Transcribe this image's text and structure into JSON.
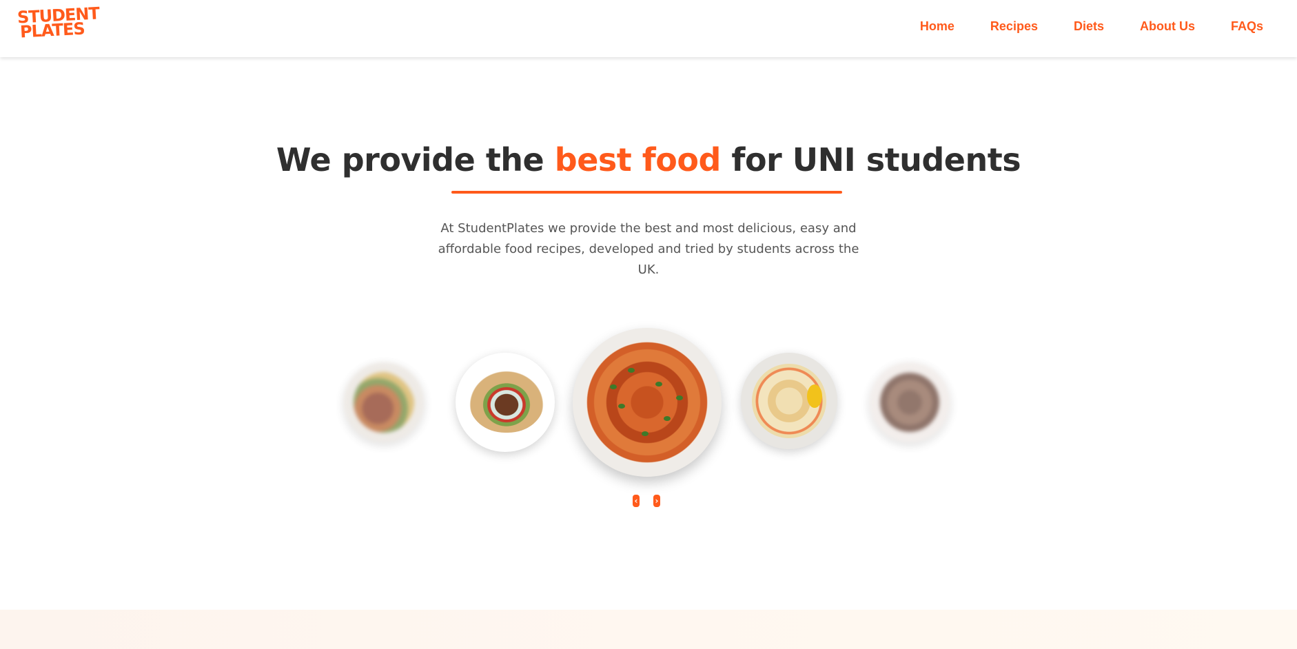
{
  "brand": {
    "logo_line1": "STUDENT",
    "logo_line2": "PLATES",
    "accent_color": "#ff5a1b"
  },
  "nav": {
    "items": [
      {
        "label": "Home"
      },
      {
        "label": "Recipes"
      },
      {
        "label": "Diets"
      },
      {
        "label": "About Us"
      },
      {
        "label": "FAQs"
      }
    ]
  },
  "hero": {
    "title_before": "We provide the ",
    "title_accent": "best food",
    "title_after": " for UNI students",
    "description": "At StudentPlates we provide the best and most delicious, easy and affordable food recipes, developed and tried by students across the UK."
  },
  "carousel": {
    "plates": [
      {
        "name": "grilled-meat-plate",
        "state": "blurred"
      },
      {
        "name": "gyro-wrap-plate",
        "state": "visible"
      },
      {
        "name": "curry-plate",
        "state": "active"
      },
      {
        "name": "shrimp-pasta-plate",
        "state": "visible"
      },
      {
        "name": "stew-plate",
        "state": "blurred"
      }
    ],
    "prev_icon": "‹",
    "next_icon": "›"
  }
}
